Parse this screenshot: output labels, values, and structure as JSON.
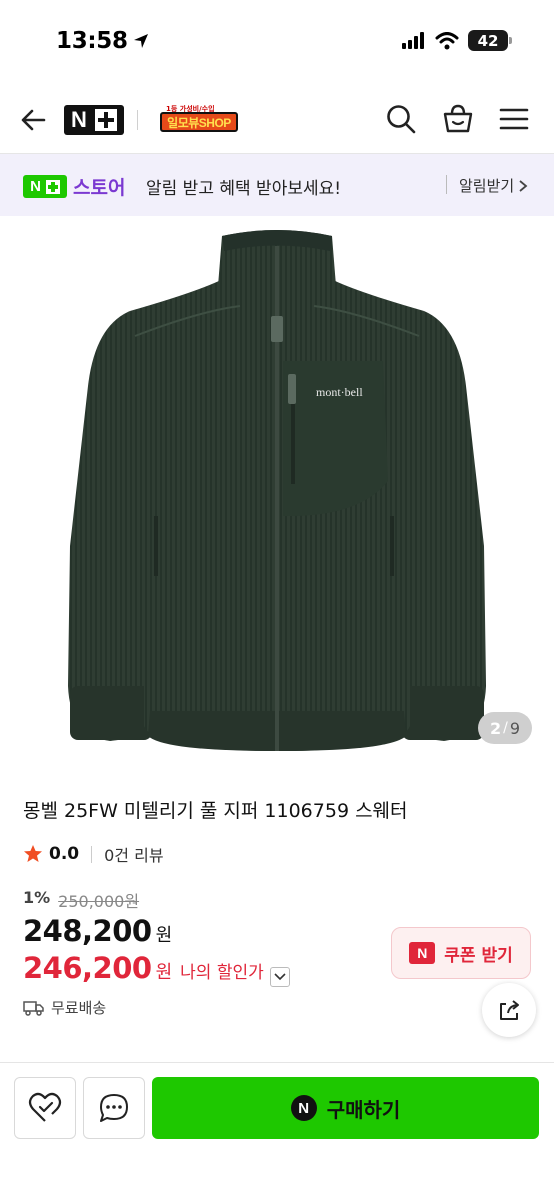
{
  "status": {
    "time": "13:58",
    "battery": "42"
  },
  "header": {
    "brand_n": "N",
    "shop_tiny": "1등 가성비/수입",
    "shop_name": "일모뷰SHOP"
  },
  "notice": {
    "brand_n": "N",
    "store": "스토어",
    "message": "알림 받고 혜택 받아보세요!",
    "cta": "알림받기"
  },
  "gallery": {
    "current": "2",
    "separator": "/",
    "total": "9",
    "logo_text": "mont·bell"
  },
  "product": {
    "title": "몽벨 25FW 미텔리기 풀 지퍼 1106759 스웨터",
    "rating": "0.0",
    "reviews": "0건 리뷰",
    "discount_rate": "1%",
    "original_price": "250,000원",
    "price": "248,200",
    "price_unit": "원",
    "my_price": "246,200",
    "my_price_unit": "원",
    "my_price_label": "나의 할인가",
    "shipping": "무료배송"
  },
  "coupon": {
    "icon_text": "N",
    "label": "쿠폰 받기"
  },
  "bottom": {
    "buy_icon": "N",
    "buy_label": "구매하기"
  },
  "colors": {
    "naver_green": "#1ec800",
    "store_purple": "#7b39d1",
    "sale_red": "#e0263a",
    "jacket": "#2d3b31"
  }
}
